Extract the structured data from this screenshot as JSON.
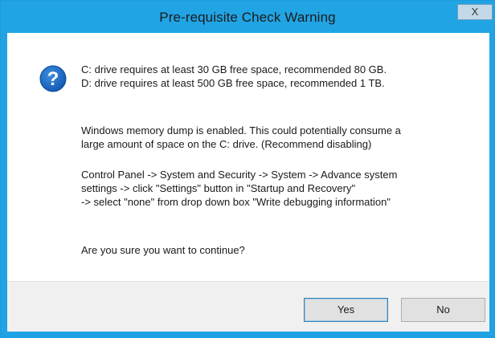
{
  "dialog": {
    "title": "Pre-requisite Check Warning",
    "close_symbol": "X",
    "icon": "question-icon",
    "icon_glyph": "?",
    "message_lines": {
      "drive_c": "C: drive requires at least 30 GB free space, recommended 80 GB.",
      "drive_d": "D: drive requires at least 500 GB free space, recommended 1 TB.",
      "dump_1": "Windows memory dump is enabled.  This could potentially consume a",
      "dump_2": "large amount of space on the C: drive. (Recommend disabling)",
      "path_1": "Control Panel -> System and Security -> System -> Advance system",
      "path_2": "settings -> click \"Settings\" button in \"Startup and Recovery\"",
      "path_3": "-> select \"none\" from drop down box \"Write debugging information\"",
      "confirm": "Are you sure you want to continue?"
    },
    "buttons": {
      "yes": "Yes",
      "no": "No"
    },
    "colors": {
      "frame": "#21a4e4",
      "icon": "#1b6fc6",
      "footer": "#f0f0f0"
    }
  }
}
